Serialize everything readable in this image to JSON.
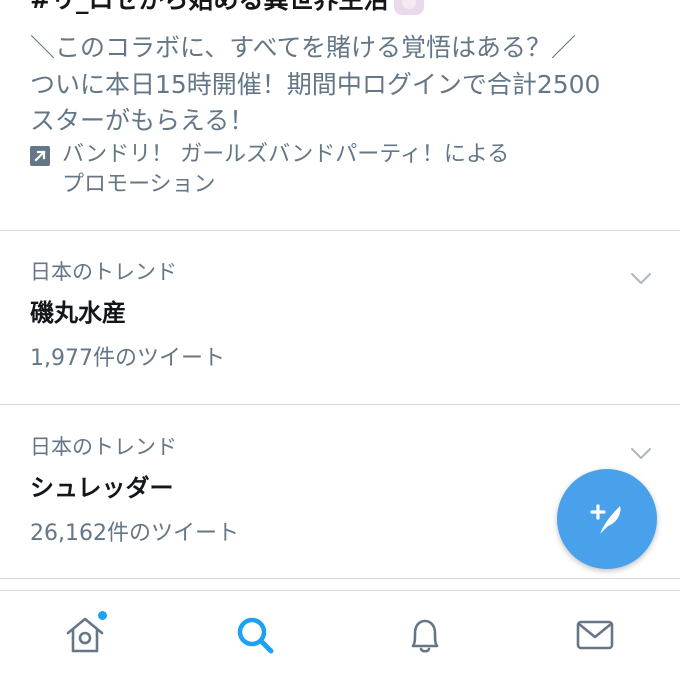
{
  "promo": {
    "title": "#リ_ロゼから始める異世界生活",
    "body": "＼このコラボに、すべてを賭ける覚悟はある？／\nついに本日15時開催！期間中ログインで合計2500\nスターがもらえる！",
    "promoted_by": "バンドリ！ ガールズバンドパーティ！による\nプロモーション",
    "promoted_icon": "promoted-arrow-icon"
  },
  "trends": [
    {
      "context": "日本のトレンド",
      "name": "磯丸水産",
      "count": "1,977件のツイート"
    },
    {
      "context": "日本のトレンド",
      "name": "シュレッダー",
      "count": "26,162件のツイート"
    }
  ],
  "fab": {
    "icon": "compose-tweet-icon",
    "color": "#4aa1eb"
  },
  "tabbar": {
    "items": [
      {
        "name": "home",
        "icon": "home-icon",
        "active": false,
        "badge": true
      },
      {
        "name": "search",
        "icon": "search-icon",
        "active": true,
        "badge": false
      },
      {
        "name": "notifications",
        "icon": "bell-icon",
        "active": false,
        "badge": false
      },
      {
        "name": "messages",
        "icon": "mail-icon",
        "active": false,
        "badge": false
      }
    ],
    "active_color": "#1da1f2",
    "inactive_color": "#657786"
  }
}
